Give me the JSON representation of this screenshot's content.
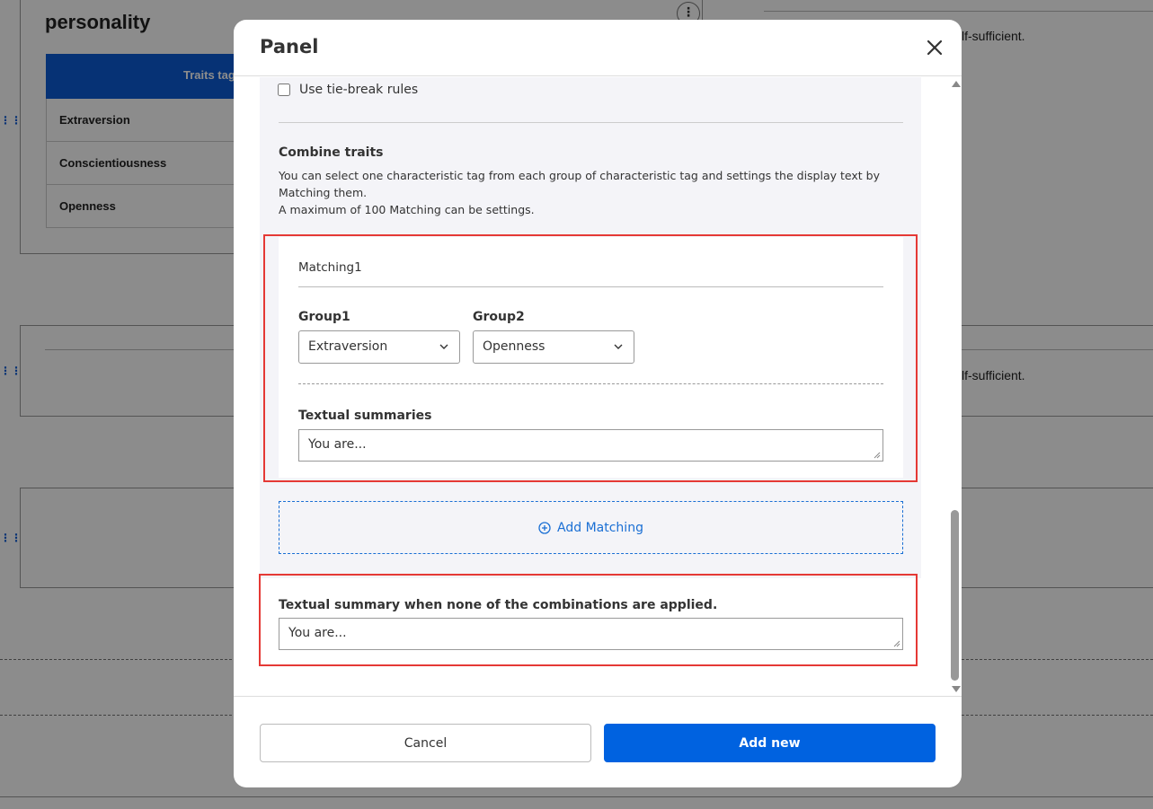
{
  "background": {
    "page_title": "personality",
    "table_header": "Traits tag",
    "table_rows": [
      "Extraversion",
      "Conscientiousness",
      "Openness"
    ],
    "right_text_1": "lf-sufficient.",
    "right_text_2": "lf-sufficient."
  },
  "modal": {
    "title": "Panel",
    "tiebreak_label": "Use tie-break rules",
    "tiebreak_checked": false,
    "combine_title": "Combine traits",
    "combine_desc_1": "You can select one characteristic tag from each group of characteristic tag and settings the display text by Matching them.",
    "combine_desc_2": "A maximum of 100 Matching can be settings.",
    "matching": {
      "title": "Matching1",
      "group1_label": "Group1",
      "group1_value": "Extraversion",
      "group2_label": "Group2",
      "group2_value": "Openness",
      "summaries_label": "Textual summaries",
      "summaries_value": "You are..."
    },
    "add_matching_label": "Add Matching",
    "none_label": "Textual summary when none of the combinations are applied.",
    "none_value": "You are...",
    "cancel_label": "Cancel",
    "add_new_label": "Add new"
  },
  "colors": {
    "primary": "#0062e0",
    "highlight": "#e53935",
    "link": "#1a6fd4"
  }
}
